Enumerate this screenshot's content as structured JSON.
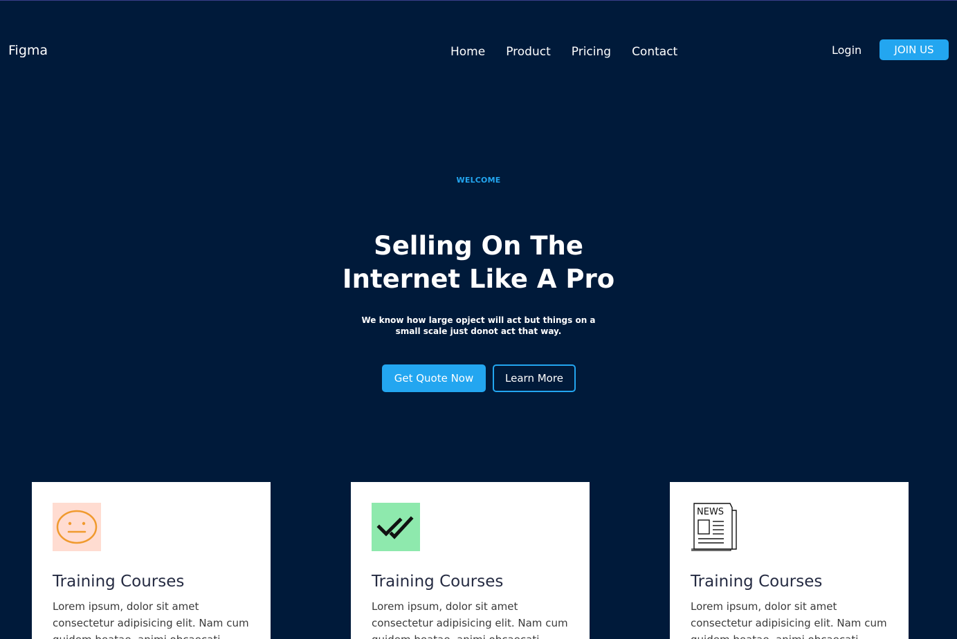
{
  "header": {
    "brand": "Figma",
    "nav": [
      "Home",
      "Product",
      "Pricing",
      "Contact"
    ],
    "login": "Login",
    "join": "JOIN US"
  },
  "hero": {
    "eyebrow": "WELCOME",
    "title_line1": "Selling On The",
    "title_line2": "Internet Like A Pro",
    "subtitle_line1": "We know how large opject will act but things on a",
    "subtitle_line2": "small scale just donot act that way.",
    "primary_button": "Get Quote Now",
    "secondary_button": "Learn More"
  },
  "cards": [
    {
      "icon": "neutral-face-icon",
      "icon_bg": "#ffdcd1",
      "title": "Training Courses",
      "text": "Lorem ipsum, dolor sit amet consectetur adipisicing elit. Nam cum quidem beatae, animi obcaecati reiciendis odit"
    },
    {
      "icon": "double-check-icon",
      "icon_bg": "#8ee9ad",
      "title": "Training Courses",
      "text": "Lorem ipsum, dolor sit amet consectetur adipisicing elit. Nam cum quidem beatae, animi obcaecati reiciendis odit"
    },
    {
      "icon": "newspaper-icon",
      "icon_bg": "#ffffff",
      "icon_text": "NEWS",
      "title": "Training Courses",
      "text": "Lorem ipsum, dolor sit amet consectetur adipisicing elit. Nam cum quidem beatae, animi obcaecati reiciendis odit"
    }
  ],
  "colors": {
    "background": "#001a3a",
    "accent": "#23a6f0",
    "card_text": "#252b42"
  }
}
